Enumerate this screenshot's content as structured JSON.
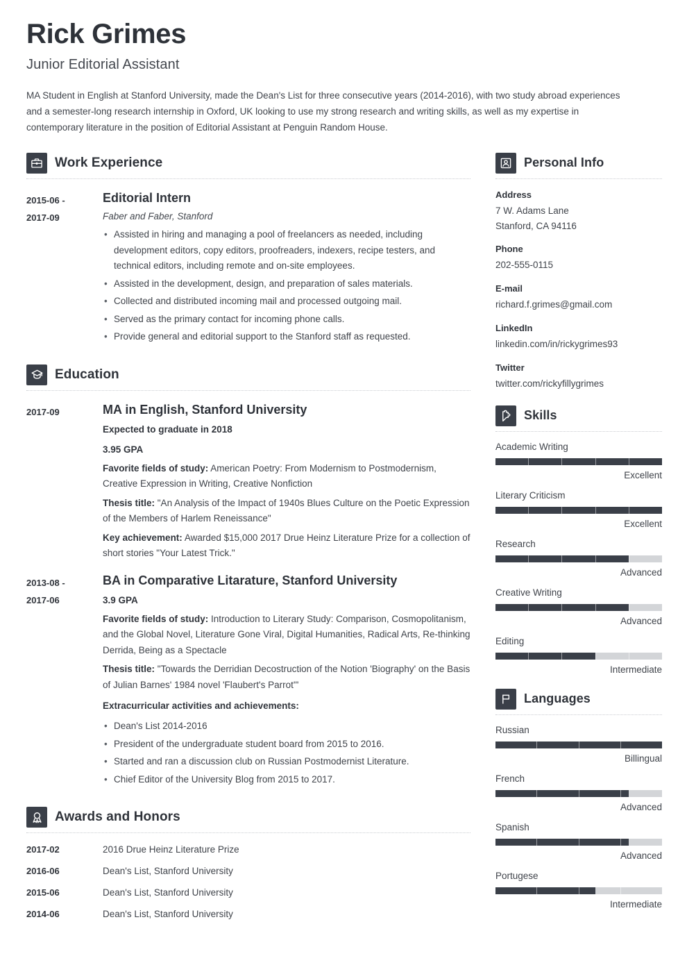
{
  "header": {
    "name": "Rick Grimes",
    "job_title": "Junior Editorial Assistant",
    "summary": "MA Student in English at Stanford University, made the Dean's List for three consecutive years (2014-2016), with two study abroad experiences and a semester-long research internship in Oxford, UK looking to use my strong research and writing skills, as well as my expertise in contemporary literature in the position of Editorial Assistant at Penguin Random House."
  },
  "sections": {
    "work_experience": {
      "title": "Work Experience",
      "icon": "briefcase-icon",
      "entries": [
        {
          "date_start": "2015-06 -",
          "date_end": "2017-09",
          "role": "Editorial Intern",
          "org": "Faber and Faber, Stanford",
          "bullets": [
            "Assisted in hiring and managing a pool of freelancers as needed, including development editors, copy editors, proofreaders, indexers, recipe testers, and technical editors, including remote and on-site employees.",
            "Assisted in the development, design, and preparation of sales materials.",
            "Collected and distributed incoming mail and processed outgoing mail.",
            "Served as the primary contact for incoming phone calls.",
            "Provide general and editorial support to the Stanford staff as requested."
          ]
        }
      ]
    },
    "education": {
      "title": "Education",
      "icon": "graduation-cap-icon",
      "entries": [
        {
          "date_start": "2017-09",
          "date_end": "",
          "degree": "MA in English, Stanford University",
          "sub_lines": [
            "Expected to graduate in 2018",
            "3.95 GPA"
          ],
          "details": [
            {
              "label": "Favorite fields of study:",
              "text": " American Poetry: From Modernism to Postmodernism, Creative Expression in Writing, Creative Nonfiction"
            },
            {
              "label": "Thesis title:",
              "text": " \"An Analysis of the Impact of 1940s Blues Culture on the Poetic Expression of the Members of Harlem Reneissance\""
            },
            {
              "label": "Key achievement:",
              "text": " Awarded $15,000 2017 Drue Heinz Literature Prize for a collection of short stories \"Your Latest Trick.\""
            }
          ],
          "bullets_heading": "",
          "bullets": []
        },
        {
          "date_start": "2013-08 -",
          "date_end": "2017-06",
          "degree": "BA in Comparative Litarature, Stanford University",
          "sub_lines": [
            "3.9 GPA"
          ],
          "details": [
            {
              "label": "Favorite fields of study:",
              "text": " Introduction to Literary Study: Comparison, Cosmopolitanism, and the Global Novel, Literature Gone Viral, Digital Humanities, Radical Arts, Re-thinking Derrida, Being as a Spectacle"
            },
            {
              "label": "Thesis title:",
              "text": " \"Towards the Derridian Decostruction of the Notion 'Biography' on the Basis of Julian Barnes' 1984 novel 'Flaubert's Parrot'\""
            }
          ],
          "bullets_heading": "Extracurricular activities and achievements:",
          "bullets": [
            "Dean's List 2014-2016",
            "President of the undergraduate student board from 2015 to 2016.",
            "Started and ran a discussion club on Russian Postmodernist Literature.",
            "Chief Editor of the University Blog from 2015 to 2017."
          ]
        }
      ]
    },
    "awards": {
      "title": "Awards and Honors",
      "icon": "award-ribbon-icon",
      "rows": [
        {
          "date": "2017-02",
          "text": "2016 Drue Heinz Literature Prize"
        },
        {
          "date": "2016-06",
          "text": "Dean's List, Stanford University"
        },
        {
          "date": "2015-06",
          "text": "Dean's List, Stanford University"
        },
        {
          "date": "2014-06",
          "text": "Dean's List, Stanford University"
        }
      ]
    },
    "personal_info": {
      "title": "Personal Info",
      "icon": "person-icon",
      "groups": [
        {
          "label": "Address",
          "values": [
            "7 W. Adams Lane",
            "Stanford, CA 94116"
          ]
        },
        {
          "label": "Phone",
          "values": [
            "202-555-0115"
          ]
        },
        {
          "label": "E-mail",
          "values": [
            "richard.f.grimes@gmail.com"
          ]
        },
        {
          "label": "LinkedIn",
          "values": [
            "linkedin.com/in/rickygrimes93"
          ]
        },
        {
          "label": "Twitter",
          "values": [
            "twitter.com/rickyfillygrimes"
          ]
        }
      ]
    },
    "skills": {
      "title": "Skills",
      "icon": "puzzle-piece-icon",
      "items": [
        {
          "name": "Academic Writing",
          "level": "Excellent",
          "percent": 100,
          "segments": 5
        },
        {
          "name": "Literary Criticism",
          "level": "Excellent",
          "percent": 100,
          "segments": 5
        },
        {
          "name": "Research",
          "level": "Advanced",
          "percent": 80,
          "segments": 5
        },
        {
          "name": "Creative Writing",
          "level": "Advanced",
          "percent": 80,
          "segments": 5
        },
        {
          "name": "Editing",
          "level": "Intermediate",
          "percent": 60,
          "segments": 5
        }
      ]
    },
    "languages": {
      "title": "Languages",
      "icon": "flag-icon",
      "items": [
        {
          "name": "Russian",
          "level": "Billingual",
          "percent": 100,
          "segments": 4
        },
        {
          "name": "French",
          "level": "Advanced",
          "percent": 80,
          "segments": 4
        },
        {
          "name": "Spanish",
          "level": "Advanced",
          "percent": 80,
          "segments": 4
        },
        {
          "name": "Portugese",
          "level": "Intermediate",
          "percent": 60,
          "segments": 4
        }
      ]
    }
  },
  "colors": {
    "icon_bg": "#3a3f48",
    "bar_fill": "#3a3f48",
    "bar_track": "#d3d5d8",
    "heading": "#2e3239",
    "body_text": "#3f434a"
  }
}
